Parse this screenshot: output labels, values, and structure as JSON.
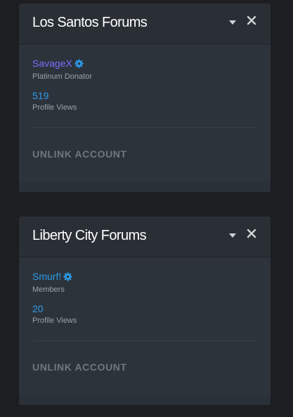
{
  "colors": {
    "background": "#1c1e21",
    "panel": "#2d333b",
    "link_blue": "#2c9be7",
    "donator_purple": "#7b6cff",
    "muted_text": "#9aa1a8",
    "button_text": "#70767c"
  },
  "panels": [
    {
      "title": "Los Santos Forums",
      "username": "SavageX",
      "username_color": "#7b6cff",
      "rank": "Platinum Donator",
      "profile_views": "519",
      "profile_views_label": "Profile Views",
      "unlink_label": "UNLINK ACCOUNT",
      "icons": {
        "dropdown": "chevron-down-icon",
        "close": "close-icon",
        "verified": "verified-badge-icon"
      }
    },
    {
      "title": "Liberty City Forums",
      "username": "Smurf!",
      "username_color": "#2c9be7",
      "rank": "Members",
      "profile_views": "20",
      "profile_views_label": "Profile Views",
      "unlink_label": "UNLINK ACCOUNT",
      "icons": {
        "dropdown": "chevron-down-icon",
        "close": "close-icon",
        "verified": "verified-badge-icon"
      }
    }
  ]
}
